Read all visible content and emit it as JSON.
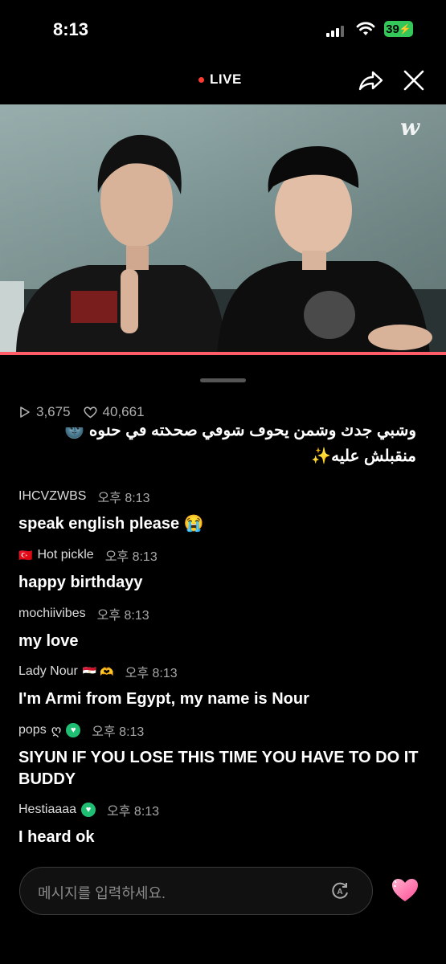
{
  "status_bar": {
    "time": "8:13",
    "battery": "39"
  },
  "header": {
    "live_label": "LIVE"
  },
  "video": {
    "logo": "w",
    "progress_accent": "#ff5d6a"
  },
  "stats": {
    "plays": "3,675",
    "likes": "40,661"
  },
  "chat": {
    "partial_message": {
      "line1": "وشبي جدك وشمن يحوف شوفي صحكته في حلوه 🌚",
      "line2": "منقبلش عليه✨"
    },
    "messages": [
      {
        "user": "IHCVZWBS",
        "time": "오후 8:13",
        "text": "speak english please 😭"
      },
      {
        "user": "Hot pickle",
        "flag": "🇹🇷",
        "time": "오후 8:13",
        "text": "happy birthdayy"
      },
      {
        "user": "mochiivibes",
        "time": "오후 8:13",
        "text": "my love"
      },
      {
        "user": "Lady Nour",
        "flag": "🇪🇬 🫶",
        "time": "오후 8:13",
        "text": "I'm Armi from Egypt, my name is Nour"
      },
      {
        "user": "pops",
        "suffix": "ღ",
        "time": "오후 8:13",
        "text": "SIYUN IF YOU LOSE THIS TIME YOU HAVE TO DO IT BUDDY"
      },
      {
        "user": "Hestiaaaa",
        "time": "오후 8:13",
        "text": "I heard ok"
      }
    ]
  },
  "input": {
    "placeholder": "메시지를 입력하세요."
  },
  "colors": {
    "badge": "#1fbf73",
    "live_dot": "#ff3b30",
    "heart": "#ff5fa2"
  }
}
